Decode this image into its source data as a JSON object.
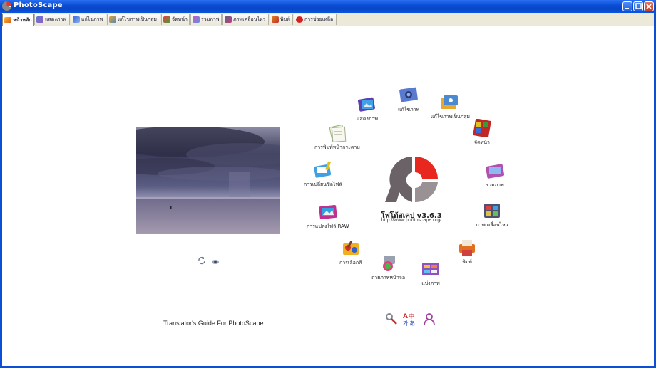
{
  "window": {
    "title": "PhotoScape"
  },
  "tabs": [
    {
      "label": "หน้าหลัก",
      "active": true
    },
    {
      "label": "แสดงภาพ",
      "active": false
    },
    {
      "label": "แก้ไขภาพ",
      "active": false
    },
    {
      "label": "แก้ไขภาพเป็นกลุ่ม",
      "active": false
    },
    {
      "label": "จัดหน้า",
      "active": false
    },
    {
      "label": "รวมภาพ",
      "active": false
    },
    {
      "label": "ภาพเคลื่อนไหว",
      "active": false
    },
    {
      "label": "พิมพ์",
      "active": false
    },
    {
      "label": "การช่วยเหลือ",
      "active": false
    }
  ],
  "menu": [
    {
      "label": "แก้ไขภาพ",
      "icon": "editor-icon"
    },
    {
      "label": "แก้ไขภาพเป็นกลุ่ม",
      "icon": "batch-editor-icon"
    },
    {
      "label": "จัดหน้า",
      "icon": "page-icon"
    },
    {
      "label": "รวมภาพ",
      "icon": "combine-icon"
    },
    {
      "label": "ภาพเคลื่อนไหว",
      "icon": "animated-gif-icon"
    },
    {
      "label": "พิมพ์",
      "icon": "print-icon"
    },
    {
      "label": "แบ่งภาพ",
      "icon": "splitter-icon"
    },
    {
      "label": "ถ่ายภาพหน้าจอ",
      "icon": "screen-capture-icon"
    },
    {
      "label": "การเลือกสี",
      "icon": "color-picker-icon"
    },
    {
      "label": "การแปลงไฟล์ RAW",
      "icon": "raw-converter-icon"
    },
    {
      "label": "การเปลี่ยนชื่อไฟล์",
      "icon": "rename-icon"
    },
    {
      "label": "การพิมพ์หน้ากระดาษ",
      "icon": "paper-print-icon"
    },
    {
      "label": "แสดงภาพ",
      "icon": "viewer-icon"
    }
  ],
  "logo": {
    "title": "โฟโต้สเคป v3.6.3",
    "url": "http://www.photoscape.org/"
  },
  "guide_link": "Translator's Guide For PhotoScape",
  "colors": {
    "titlebar": "#0a4fd6",
    "tabbar": "#ece9d8",
    "logo_red": "#e8271e",
    "logo_gray": "#9a9195"
  }
}
